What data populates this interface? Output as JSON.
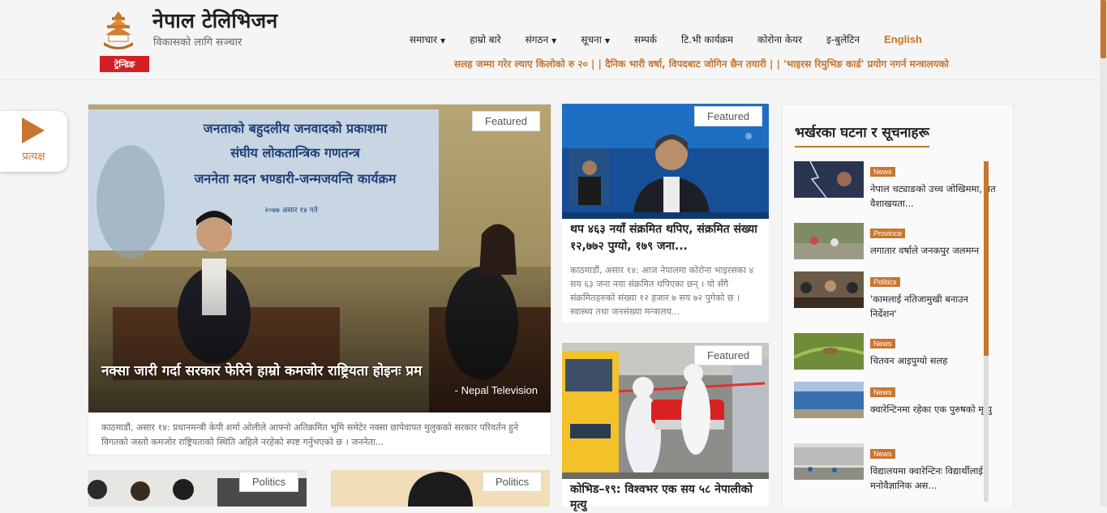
{
  "header": {
    "site_title": "नेपाल टेलिभिजन",
    "site_subtitle": "विकासको लागि सञ्चार",
    "trending_label": "ट्रेन्डिङ",
    "ticker_text": "सलह जम्मा गरेर ल्याए किलोको रु २० | | दैनिक भारी वर्षा, विपदबाट जोगिन छैन तयारी | | 'भाइरस रिमुभिङ कार्ड' प्रयोग नगर्न मन्त्रालयको",
    "accent_color": "#c8762f"
  },
  "nav": {
    "items": [
      "समाचार",
      "हाम्रो बारे",
      "संगठन",
      "सूचना",
      "सम्पर्क",
      "टि.भी कार्यक्रम",
      "कोरोना केयर",
      "इ-बुलेटिन"
    ],
    "dropdowns": [
      true,
      false,
      true,
      true,
      false,
      false,
      false,
      false
    ],
    "english": "English"
  },
  "live": {
    "label": "प्रत्यक्ष"
  },
  "featured_label": "Featured",
  "politics_label": "Politics",
  "main_story": {
    "banner_line1": "जनताको बहुदलीय जनवादको प्रकाशमा",
    "banner_line2": "संघीय लोकतान्त्रिक गणतन्त्र",
    "banner_line3": "जननेता मदन भण्डारी-जन्मजयन्ति कार्यक्रम",
    "banner_line4": "२०७७ असार १४ गते",
    "headline": "नक्सा जारी गर्दा सरकार फेरिने हाम्रो कमजोर राष्ट्रियता होइनः प्रम",
    "credit": "- Nepal Television",
    "excerpt": "काठमाडौं, असार १४: प्रधानमन्त्री केपी शर्मा ओलीले आफ्नो अतिक्रमित भूमि समेटेर नक्सा छापेवापत मुलुकको सरकार परिवर्तन हुने विगतको जस्तो कमजोर राष्ट्रियताको स्थिति अहिले नरहेको स्पष्ट गर्नुभएको छ । जननेता..."
  },
  "side_stories": [
    {
      "title": "थप ४६३ नयाँ संक्रमित थपिए, संक्रमित संख्या १२,७७२ पुग्यो, १७९ जना...",
      "excerpt": "काठमाडौं, असार १४: आज नेपालमा कोरोना भाइरसका ४ सय ६३ जना नया संक्रमित थपिएका छन् । यो सँगै संक्रमितहरुको संख्या १२ हजार ७ सय ७२ पुगेको छ । स्वास्थ्य तथा जनसंख्या मन्त्रालय..."
    },
    {
      "title": "कोभिड–१९: विश्वभर एक सय ५८ नेपालीको मृत्यु",
      "excerpt": ""
    }
  ],
  "right_panel": {
    "heading": "भर्खरका घटना र सूचनाहरू",
    "items": [
      {
        "category": "News",
        "title": "नेपाल चट्याङको उच्च जोखिममा, गत वैशाखयता..."
      },
      {
        "category": "Province",
        "title": "लगातार वर्षाले जनकपुर जलमग्न"
      },
      {
        "category": "Politics",
        "title": "'कामलाई नतिजामुखी बनाउन निर्देशन'"
      },
      {
        "category": "News",
        "title": "चितवन आइपुग्यो सलह"
      },
      {
        "category": "News",
        "title": "क्वारेन्टिनमा रहेका एक पुरुषको मृत्यु"
      },
      {
        "category": "News",
        "title": "विद्यालयमा क्वारेन्टिनः विद्यार्थीलाई मनोवैज्ञानिक अस..."
      }
    ]
  }
}
